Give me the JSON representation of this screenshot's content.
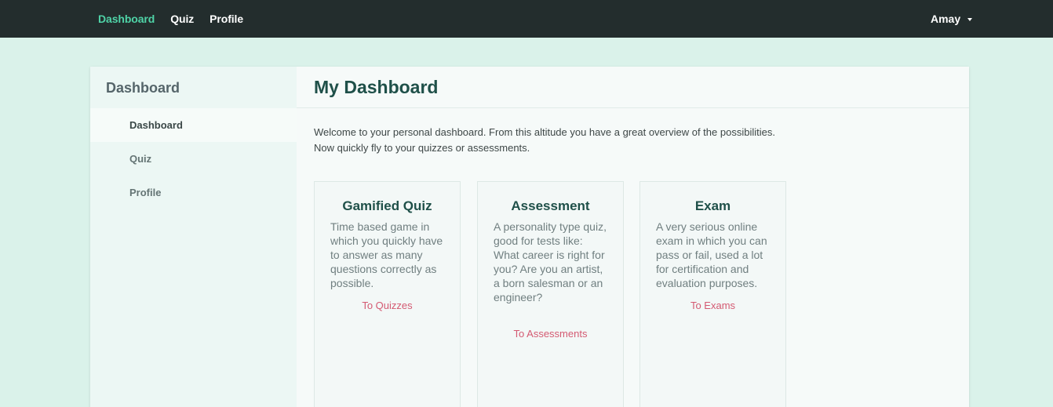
{
  "topnav": {
    "items": [
      {
        "label": "Dashboard",
        "active": true
      },
      {
        "label": "Quiz",
        "active": false
      },
      {
        "label": "Profile",
        "active": false
      }
    ],
    "user": "Amay"
  },
  "sidebar": {
    "title": "Dashboard",
    "items": [
      {
        "label": "Dashboard",
        "active": true
      },
      {
        "label": "Quiz",
        "active": false
      },
      {
        "label": "Profile",
        "active": false
      }
    ]
  },
  "main": {
    "title": "My Dashboard",
    "intro_line1": "Welcome to your personal dashboard. From this altitude you have a great overview of the possibilities.",
    "intro_line2": "Now quickly fly to your quizzes or assessments.",
    "cards": [
      {
        "title": "Gamified Quiz",
        "description": "Time based game in which you quickly have to answer as many questions correctly as possible.",
        "link": "To Quizzes"
      },
      {
        "title": "Assessment",
        "description": "A personality type quiz, good for tests like: What career is right for you? Are you an artist, a born salesman or an engineer?",
        "link": "To Assessments"
      },
      {
        "title": "Exam",
        "description": "A very serious online exam in which you can pass or fail, used a lot for certification and evaluation purposes.",
        "link": "To Exams"
      }
    ]
  },
  "colors": {
    "background": "#daf2ea",
    "topbar": "#232d2d",
    "nav_active": "#4fd3a7",
    "title": "#1f5049",
    "link": "#d45a72"
  }
}
